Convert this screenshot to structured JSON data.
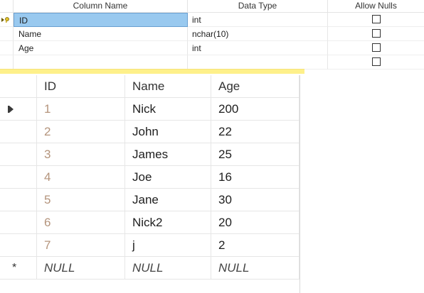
{
  "designer": {
    "headers": {
      "column_name": "Column Name",
      "data_type": "Data Type",
      "allow_nulls": "Allow Nulls"
    },
    "rows": [
      {
        "name": "ID",
        "type": "int",
        "allow_nulls": false,
        "selected": true
      },
      {
        "name": "Name",
        "type": "nchar(10)",
        "allow_nulls": false,
        "selected": false
      },
      {
        "name": "Age",
        "type": "int",
        "allow_nulls": false,
        "selected": false
      },
      {
        "name": "",
        "type": "",
        "allow_nulls": false,
        "selected": false
      }
    ]
  },
  "grid": {
    "headers": {
      "id": "ID",
      "name": "Name",
      "age": "Age"
    },
    "rows": [
      {
        "id": "1",
        "name": "Nick",
        "age": "200",
        "current": true
      },
      {
        "id": "2",
        "name": "John",
        "age": "22"
      },
      {
        "id": "3",
        "name": "James",
        "age": "25"
      },
      {
        "id": "4",
        "name": "Joe",
        "age": "16"
      },
      {
        "id": "5",
        "name": "Jane",
        "age": "30"
      },
      {
        "id": "6",
        "name": "Nick2",
        "age": "20"
      },
      {
        "id": "7",
        "name": "j",
        "age": "2"
      }
    ],
    "new_row": {
      "id": "NULL",
      "name": "NULL",
      "age": "NULL"
    }
  },
  "colors": {
    "selection": "#99c9ef",
    "yellow_bar": "#fef08a",
    "id_text": "#b4947c"
  }
}
